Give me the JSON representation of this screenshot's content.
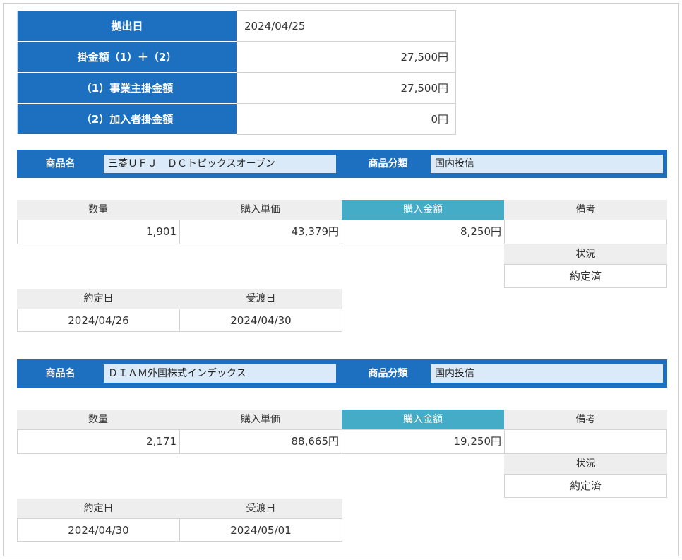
{
  "summary": {
    "rows": [
      {
        "label": "拠出日",
        "value": "2024/04/25"
      },
      {
        "label": "掛金額（1）＋（2）",
        "value": "27,500円"
      },
      {
        "label": "（1）事業主掛金額",
        "value": "27,500円"
      },
      {
        "label": "（2）加入者掛金額",
        "value": "0円"
      }
    ]
  },
  "labels": {
    "product_name": "商品名",
    "product_category": "商品分類",
    "quantity": "数量",
    "unit_price": "購入単価",
    "amount": "購入金額",
    "remarks": "備考",
    "status": "状況",
    "contract_date": "約定日",
    "settlement_date": "受渡日"
  },
  "products": [
    {
      "name": "三菱ＵＦＪ　ＤＣトピックスオープン",
      "category": "国内投信",
      "quantity": "1,901",
      "unit_price": "43,379円",
      "amount": "8,250円",
      "remarks": "",
      "status": "約定済",
      "contract_date": "2024/04/26",
      "settlement_date": "2024/04/30"
    },
    {
      "name": "ＤＩＡＭ外国株式インデックス",
      "category": "国内投信",
      "quantity": "2,171",
      "unit_price": "88,665円",
      "amount": "19,250円",
      "remarks": "",
      "status": "約定済",
      "contract_date": "2024/04/30",
      "settlement_date": "2024/05/01"
    }
  ],
  "colors": {
    "header_blue": "#1d6fbf",
    "highlight_teal": "#45acc8",
    "label_gray": "#eeeeee"
  }
}
